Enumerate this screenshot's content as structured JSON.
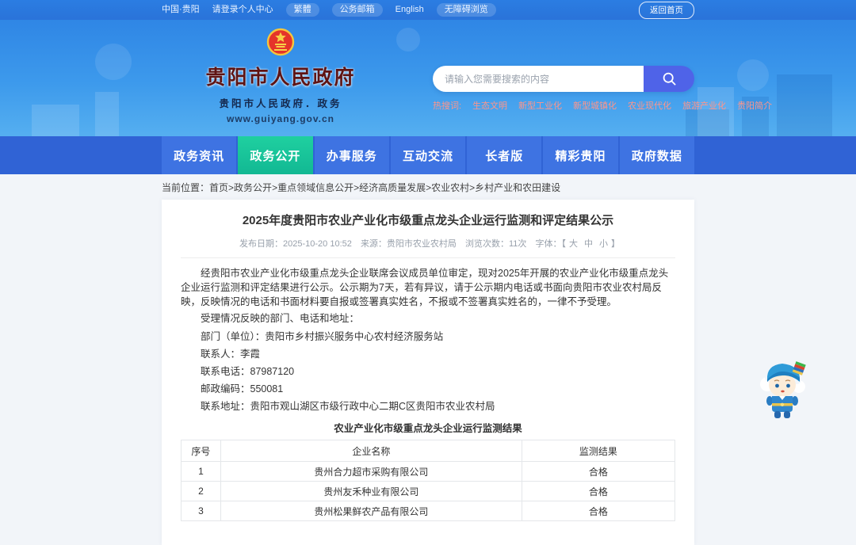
{
  "topbar": {
    "items": [
      "中国·贵阳",
      "请登录个人中心",
      "繁體",
      "公务邮箱",
      "English",
      "无障碍浏览"
    ],
    "home_button": "返回首页"
  },
  "header": {
    "site_title": "贵阳市人民政府",
    "site_subtitle": "贵阳市人民政府．政务",
    "site_url": "www.guiyang.gov.cn",
    "search": {
      "placeholder": "请输入您需要搜索的内容"
    },
    "hot": {
      "label": "热搜词:",
      "words": [
        "生态文明",
        "新型工业化",
        "新型城镇化",
        "农业现代化",
        "旅游产业化",
        "贵阳简介"
      ]
    }
  },
  "nav": {
    "items": [
      {
        "label": "政务资讯",
        "active": false
      },
      {
        "label": "政务公开",
        "active": true
      },
      {
        "label": "办事服务",
        "active": false
      },
      {
        "label": "互动交流",
        "active": false
      },
      {
        "label": "长者版",
        "active": false
      },
      {
        "label": "精彩贵阳",
        "active": false
      },
      {
        "label": "政府数据",
        "active": false
      }
    ]
  },
  "breadcrumb": {
    "label": "当前位置：",
    "items": [
      "首页",
      "政务公开",
      "重点领域信息公开",
      "经济高质量发展",
      "农业农村",
      "乡村产业和农田建设"
    ],
    "separator": ">"
  },
  "article": {
    "title": "2025年度贵阳市农业产业化市级重点龙头企业运行监测和评定结果公示",
    "meta": {
      "publish": "发布日期：2025-10-20 10:52",
      "source": "来源：贵阳市农业农村局",
      "views": "浏览次数：11次",
      "font_label": "字体：",
      "bracket_open": "【",
      "bracket_close": "】",
      "font_sizes": [
        "大",
        "中",
        "小"
      ]
    },
    "paragraphs": [
      "经贵阳市农业产业化市级重点龙头企业联席会议成员单位审定，现对2025年开展的农业产业化市级重点龙头企业运行监测和评定结果进行公示。公示期为7天，若有异议，请于公示期内电话或书面向贵阳市农业农村局反映，反映情况的电话和书面材料要自报或签署真实姓名，不报或不签署真实姓名的，一律不予受理。",
      "受理情况反映的部门、电话和地址："
    ],
    "contact_lines": [
      "部门（单位）：贵阳市乡村振兴服务中心农村经济服务站",
      "联系人：李霞",
      "联系电话：87987120",
      "邮政编码：550081",
      "联系地址：贵阳市观山湖区市级行政中心二期C区贵阳市农业农村局"
    ],
    "table": {
      "caption": "农业产业化市级重点龙头企业运行监测结果",
      "headers": [
        "序号",
        "企业名称",
        "监测结果"
      ],
      "rows": [
        [
          "1",
          "贵州合力超市采购有限公司",
          "合格"
        ],
        [
          "2",
          "贵州友禾种业有限公司",
          "合格"
        ],
        [
          "3",
          "贵州松果鲜农产品有限公司",
          "合格"
        ]
      ]
    }
  },
  "colors": {
    "topbar_blue": "#2a73d9",
    "banner_blue": "#3d9aec",
    "nav_blue": "#3e73e2",
    "nav_active_green": "#14bd96",
    "search_button_indigo": "#4f63e8",
    "hot_word_red": "#ff958b",
    "site_title_maroon": "#5e1414"
  }
}
